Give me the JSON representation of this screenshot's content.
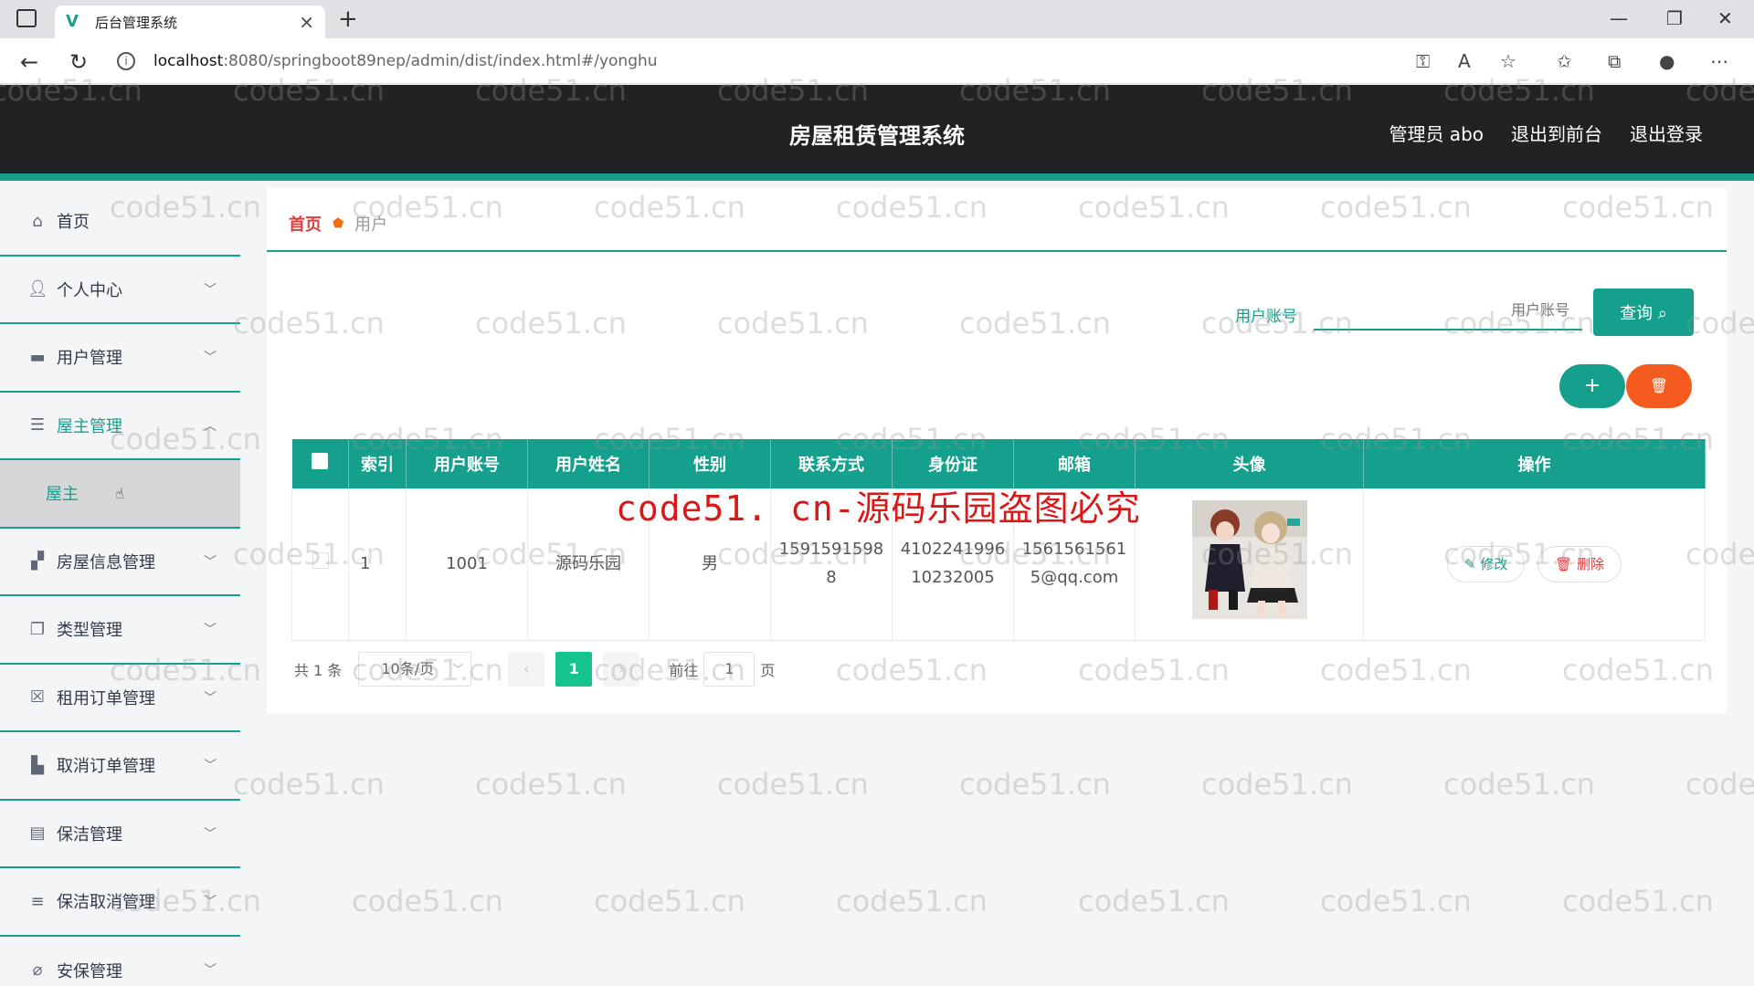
{
  "browser": {
    "tab_title": "后台管理系统",
    "url_host": "localhost",
    "url_path": ":8080/springboot89nep/admin/dist/index.html#/yonghu"
  },
  "header": {
    "title": "房屋租赁管理系统",
    "user": "管理员 abo",
    "front_link": "退出到前台",
    "logout_link": "退出登录"
  },
  "sidebar": {
    "items": [
      {
        "label": "首页",
        "icon": "home-icon"
      },
      {
        "label": "个人中心",
        "icon": "user-icon"
      },
      {
        "label": "用户管理",
        "icon": "monitor-icon"
      },
      {
        "label": "屋主管理",
        "icon": "sliders-icon"
      },
      {
        "label": "屋主",
        "icon": ""
      },
      {
        "label": "房屋信息管理",
        "icon": "house-icon"
      },
      {
        "label": "类型管理",
        "icon": "copy-icon"
      },
      {
        "label": "租用订单管理",
        "icon": "order-icon"
      },
      {
        "label": "取消订单管理",
        "icon": "cancel-icon"
      },
      {
        "label": "保洁管理",
        "icon": "clipboard-icon"
      },
      {
        "label": "保洁取消管理",
        "icon": "list-icon"
      },
      {
        "label": "安保管理",
        "icon": "shield-icon"
      }
    ]
  },
  "breadcrumb": {
    "home": "首页",
    "current": "用户"
  },
  "search": {
    "label": "用户账号",
    "placeholder": "用户账号",
    "button": "查询"
  },
  "table": {
    "headers": [
      "索引",
      "用户账号",
      "用户姓名",
      "性别",
      "联系方式",
      "身份证",
      "邮箱",
      "头像",
      "操作"
    ],
    "rows": [
      {
        "index": "1",
        "account": "1001",
        "name": "源码乐园",
        "gender": "男",
        "phone_l1": "1591591598",
        "phone_l2": "8",
        "idcard_l1": "4102241996",
        "idcard_l2": "10232005",
        "email_l1": "1561561561",
        "email_l2": "5@qq.com",
        "edit": "修改",
        "delete": "删除"
      }
    ]
  },
  "pager": {
    "total": "共 1 条",
    "size": "10条/页",
    "current": "1",
    "goto": "前往",
    "goto_value": "1",
    "page_unit": "页"
  },
  "overlay": {
    "red_text": "code51. cn-源码乐园盗图必究",
    "watermark": "code51.cn"
  },
  "colors": {
    "accent": "#14a08c",
    "header_bg": "#222222",
    "danger": "#f55a1e",
    "red": "#d91818"
  }
}
